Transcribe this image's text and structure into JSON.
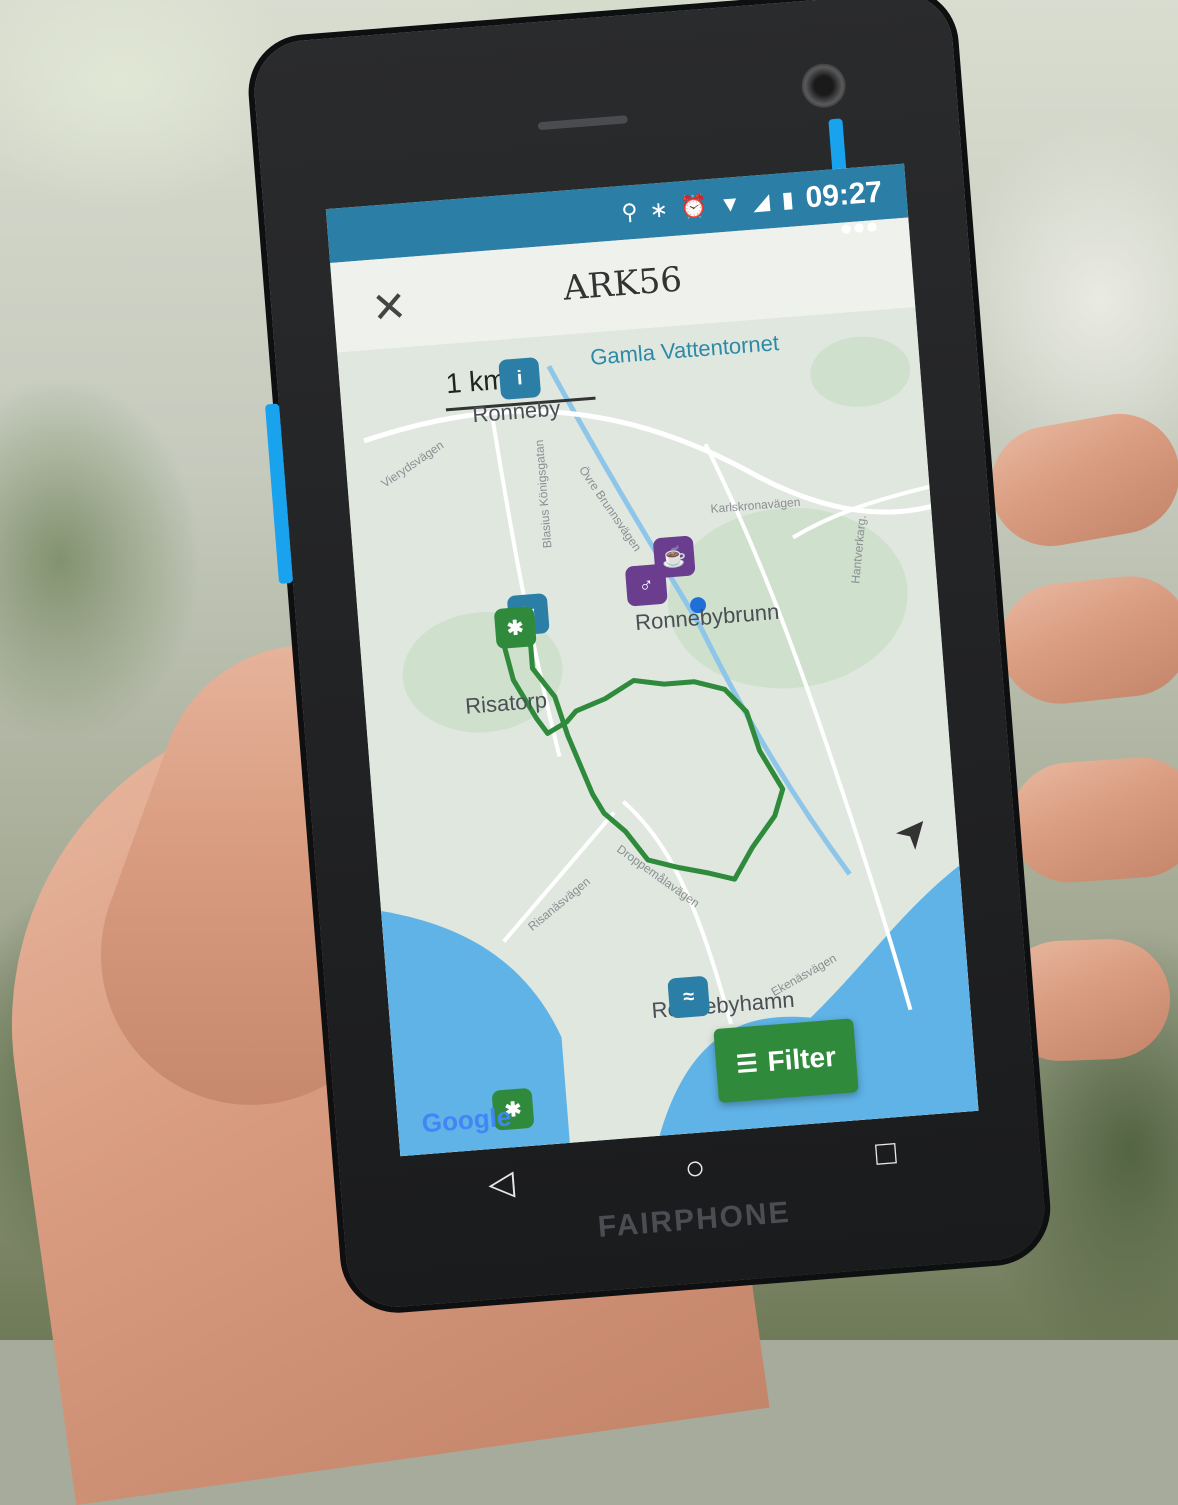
{
  "app": {
    "title": "ARK56"
  },
  "status_bar": {
    "time": "09:27"
  },
  "map": {
    "scale": "1 km",
    "poi": "Gamla Vattentornet",
    "labels": {
      "ronneby": "Ronneby",
      "ronnebybrunn": "Ronnebybrunn",
      "risatorp": "Risatorp",
      "ronnebyhamn": "Ronnebyhamn"
    },
    "roads": [
      "Karlskronavägen",
      "Blasius Königsgatan",
      "Övre Brunnsvägen",
      "Droppemålavägen",
      "Risanäsvägen",
      "Vierydsvägen",
      "Ekenäsvägen",
      "Hantverkarg."
    ],
    "attribution": "Google"
  },
  "filter": {
    "label": "Filter"
  },
  "device": {
    "brand": "FAIRPHONE"
  },
  "colors": {
    "accent": "#2b7fa6",
    "route": "#2f8a3c",
    "poi_purple": "#6a3d8f"
  },
  "icons": [
    "location-icon",
    "bluetooth-icon",
    "alarm-icon",
    "wifi-icon",
    "signal-icon",
    "battery-icon",
    "close-icon",
    "more-icon",
    "info-icon",
    "navigate-icon",
    "filter-icon",
    "back-icon",
    "home-icon",
    "recents-icon"
  ]
}
